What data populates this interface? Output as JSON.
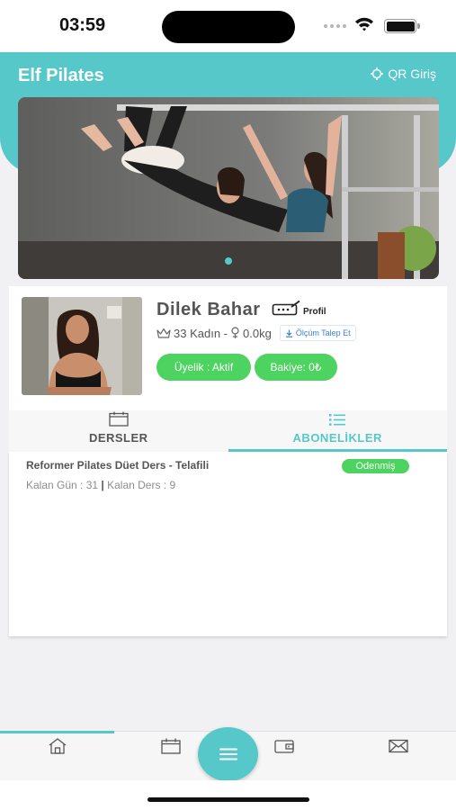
{
  "status_bar": {
    "time": "03:59"
  },
  "header": {
    "title": "Elf Pilates",
    "qr_label": "QR Giriş"
  },
  "profile": {
    "name": "Dilek Bahar",
    "profile_label": "Profil",
    "meta": "33 Kadın - ",
    "weight": "0.0kg",
    "measure_request_label": "Ölçüm Talep Et",
    "membership_label": "Üyelik : Aktif",
    "balance_label": "Bakiye: 0₺"
  },
  "tabs": [
    {
      "label": "DERSLER",
      "icon": "calendar-icon",
      "active": false
    },
    {
      "label": "ABONELİKLER",
      "icon": "list-icon",
      "active": true
    }
  ],
  "subscriptions": [
    {
      "title": "Reformer Pilates Düet Ders - Telafili",
      "status": "Odenmiş",
      "remaining_days": "Kalan Gün : 31",
      "separator": "|",
      "remaining_lessons": "Kalan Ders : 9"
    }
  ],
  "bottom_nav": [
    {
      "icon": "home-icon",
      "active": true
    },
    {
      "icon": "calendar-icon",
      "active": false
    },
    {
      "icon": "menu-icon",
      "active": false
    },
    {
      "icon": "wallet-icon",
      "active": false
    },
    {
      "icon": "mail-icon",
      "active": false
    }
  ],
  "colors": {
    "accent": "#56c8c9",
    "success": "#4cd360",
    "link": "#3b7fd4"
  }
}
